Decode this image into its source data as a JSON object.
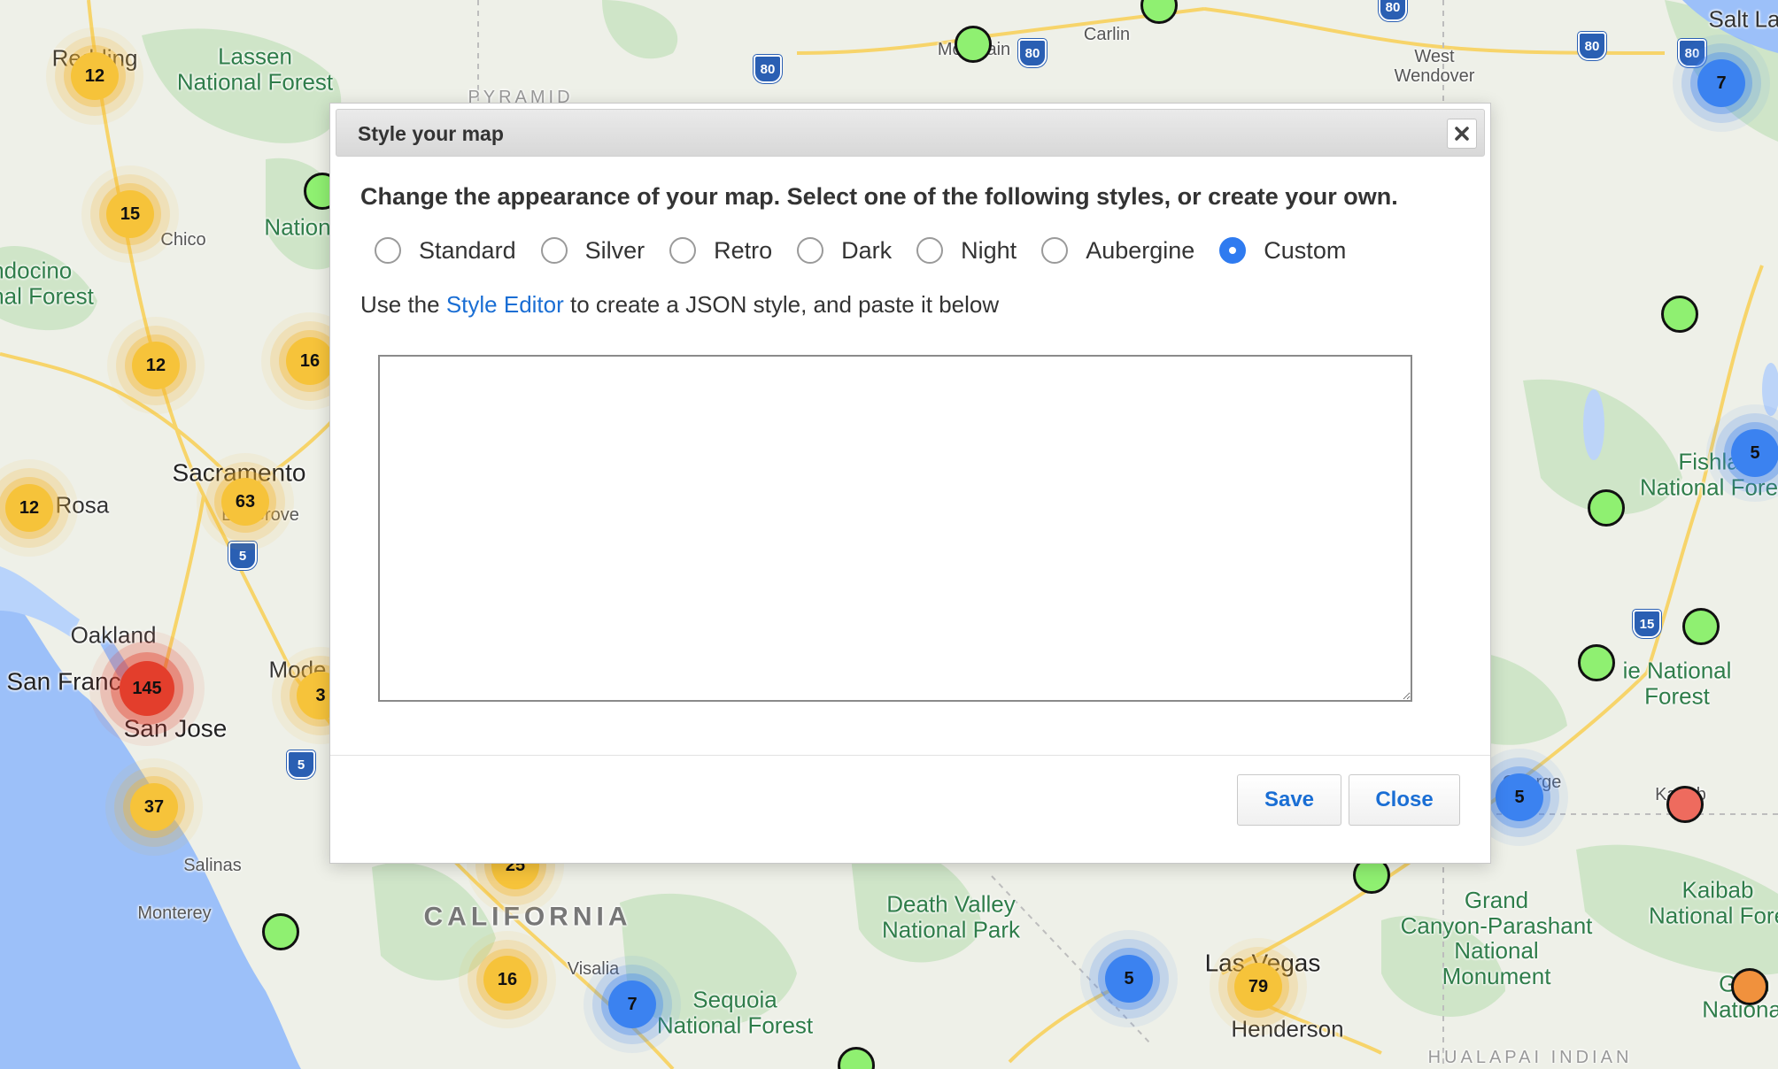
{
  "dialog": {
    "title": "Style your map",
    "intro": "Change the appearance of your map. Select one of the following styles, or create your own.",
    "style_options": [
      {
        "label": "Standard",
        "checked": false
      },
      {
        "label": "Silver",
        "checked": false
      },
      {
        "label": "Retro",
        "checked": false
      },
      {
        "label": "Dark",
        "checked": false
      },
      {
        "label": "Night",
        "checked": false
      },
      {
        "label": "Aubergine",
        "checked": false
      },
      {
        "label": "Custom",
        "checked": true
      }
    ],
    "hint_before": "Use the ",
    "hint_link": "Style Editor",
    "hint_after": " to create a JSON style, and paste it below",
    "json_value": "",
    "save_label": "Save",
    "close_label": "Close",
    "close_icon": "close-icon"
  },
  "map": {
    "labels": {
      "redding": "Redding",
      "lassen": "Lassen\nNational Forest",
      "chico": "Chico",
      "mendocino": "ndocino\nnal Forest",
      "nation_partial": "Nation",
      "sacramento": "Sacramento",
      "santa_rosa": "a Rosa",
      "elk_grove": "Elk Grove",
      "oakland": "Oakland",
      "san_francisco": "San Franc",
      "san_jose": "San Jose",
      "modesto": "Mode",
      "salinas": "Salinas",
      "monterey": "Monterey",
      "california": "CALIFORNIA",
      "visalia": "Visalia",
      "sequoia": "Sequoia\nNational Forest",
      "death_valley": "Death Valley\nNational Park",
      "las_vegas": "Las Vegas",
      "henderson": "Henderson",
      "grand_canyon": "Grand\nCanyon-Parashant\nNational\nMonument",
      "kaibab": "Kaibab\nNational Fore",
      "grand_partial": "Gran\nNational",
      "dixie": "ie National\nForest",
      "fishlake": "Fishla\nNational Fore",
      "salt_lake": "Salt La",
      "west_wendover": "West\nWendover",
      "carlin": "Carlin",
      "battle_mountain": "Mountain",
      "pyramid": "PYRAMID",
      "hualapai": "HUALAPAI INDIAN",
      "george": "George",
      "kanab": "Kanab"
    },
    "clusters": [
      {
        "name": "cluster-redding",
        "count": "12",
        "color": "yellow"
      },
      {
        "name": "cluster-chico",
        "count": "15",
        "color": "yellow"
      },
      {
        "name": "cluster-valley",
        "count": "12",
        "color": "yellow"
      },
      {
        "name": "cluster-foothills",
        "count": "16",
        "color": "yellow"
      },
      {
        "name": "cluster-sacramento",
        "count": "63",
        "color": "yellow"
      },
      {
        "name": "cluster-santa-rosa",
        "count": "12",
        "color": "yellow"
      },
      {
        "name": "cluster-bay-area",
        "count": "145",
        "color": "red"
      },
      {
        "name": "cluster-modesto",
        "count": "3",
        "color": "yellow"
      },
      {
        "name": "cluster-san-jose-south",
        "count": "37",
        "color": "yellow"
      },
      {
        "name": "cluster-fresno",
        "count": "25",
        "color": "yellow"
      },
      {
        "name": "cluster-hanford",
        "count": "16",
        "color": "yellow"
      },
      {
        "name": "cluster-visalia",
        "count": "7",
        "color": "blue"
      },
      {
        "name": "cluster-pahrump",
        "count": "5",
        "color": "blue"
      },
      {
        "name": "cluster-las-vegas",
        "count": "79",
        "color": "yellow"
      },
      {
        "name": "cluster-st-george",
        "count": "5",
        "color": "blue"
      },
      {
        "name": "cluster-salt-lake",
        "count": "7",
        "color": "blue"
      },
      {
        "name": "cluster-fishlake",
        "count": "5",
        "color": "blue"
      }
    ],
    "colors": {
      "cluster_yellow": "#f6c33a",
      "cluster_blue": "#3b82f0",
      "cluster_red": "#e33e2c",
      "marker_green": "#8ff071",
      "marker_salmon": "#ee6b5e",
      "marker_orange": "#f0913d",
      "link": "#1a6ed4",
      "radio_selected": "#2f7bf0"
    },
    "shields": [
      "80",
      "80",
      "80",
      "80",
      "80",
      "5",
      "5",
      "15"
    ]
  }
}
